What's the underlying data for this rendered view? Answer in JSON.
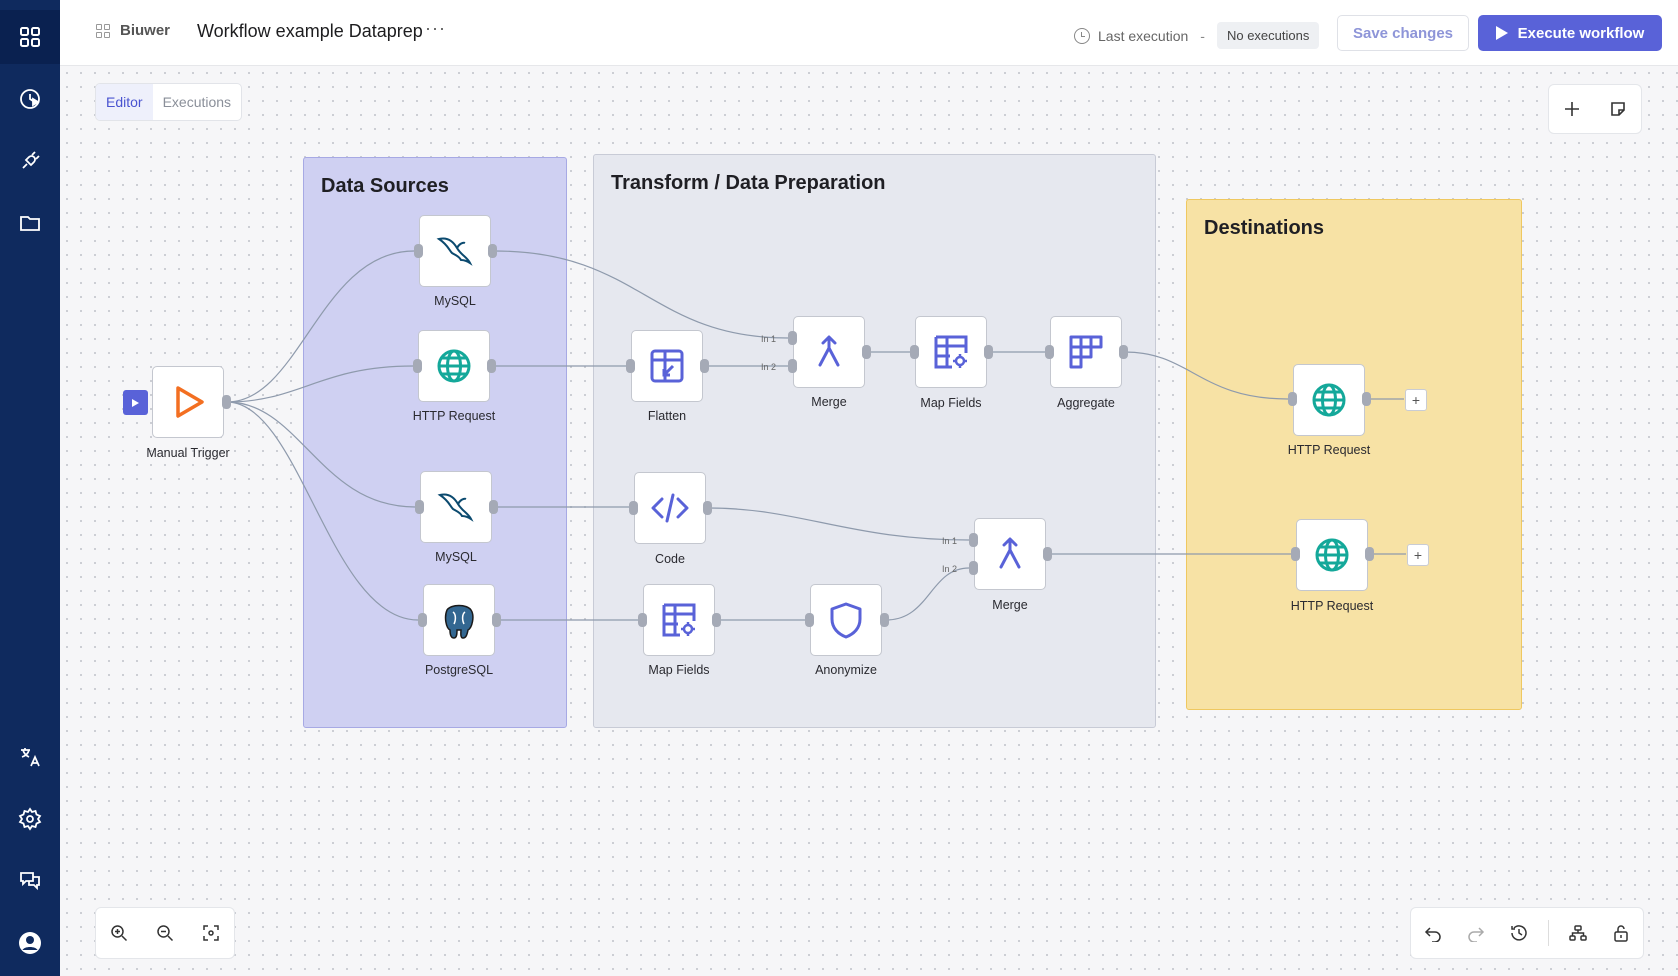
{
  "header": {
    "brand": "Biuwer",
    "workflow_title": "Workflow example Dataprep",
    "more": "···",
    "last_execution_label": "Last execution",
    "last_execution_sep": "-",
    "last_execution_value": "No executions",
    "save_label": "Save changes",
    "execute_label": "Execute workflow"
  },
  "tabs": [
    {
      "label": "Editor",
      "active": true
    },
    {
      "label": "Executions",
      "active": false
    }
  ],
  "groups": {
    "sources": "Data Sources",
    "transform": "Transform / Data Preparation",
    "destinations": "Destinations"
  },
  "nodes": {
    "trigger": "Manual Trigger",
    "mysql1": "MySQL",
    "http1": "HTTP Request",
    "mysql2": "MySQL",
    "postgres": "PostgreSQL",
    "flatten": "Flatten",
    "merge1": "Merge",
    "mapfields1": "Map Fields",
    "aggregate": "Aggregate",
    "code": "Code",
    "mapfields2": "Map Fields",
    "anonymize": "Anonymize",
    "merge2": "Merge",
    "dest_http1": "HTTP Request",
    "dest_http2": "HTTP Request"
  },
  "ports": {
    "in1": "In 1",
    "in2": "In 2",
    "plus": "+"
  },
  "colors": {
    "sidebar": "#0f2a5e",
    "accent": "#5962d8",
    "sources_bg": "#cfd0f2",
    "transform_bg": "#e6e8ef",
    "destinations_bg": "#f7e2a5",
    "trigger_orange": "#f36f21",
    "http_teal": "#14a89a",
    "mysql_blue": "#0b4a6f"
  },
  "icons": {
    "sidebar": [
      "dashboard-icon",
      "history-icon",
      "plug-icon",
      "folder-icon",
      "translate-icon",
      "settings-icon",
      "chat-icon",
      "user-icon"
    ],
    "top_tools": [
      "plus-icon",
      "sticky-note-icon"
    ],
    "zoom_tools": [
      "zoom-in-icon",
      "zoom-out-icon",
      "fit-view-icon"
    ],
    "history_tools": [
      "undo-icon",
      "redo-icon",
      "history-icon",
      "layout-icon",
      "unlock-icon"
    ]
  }
}
